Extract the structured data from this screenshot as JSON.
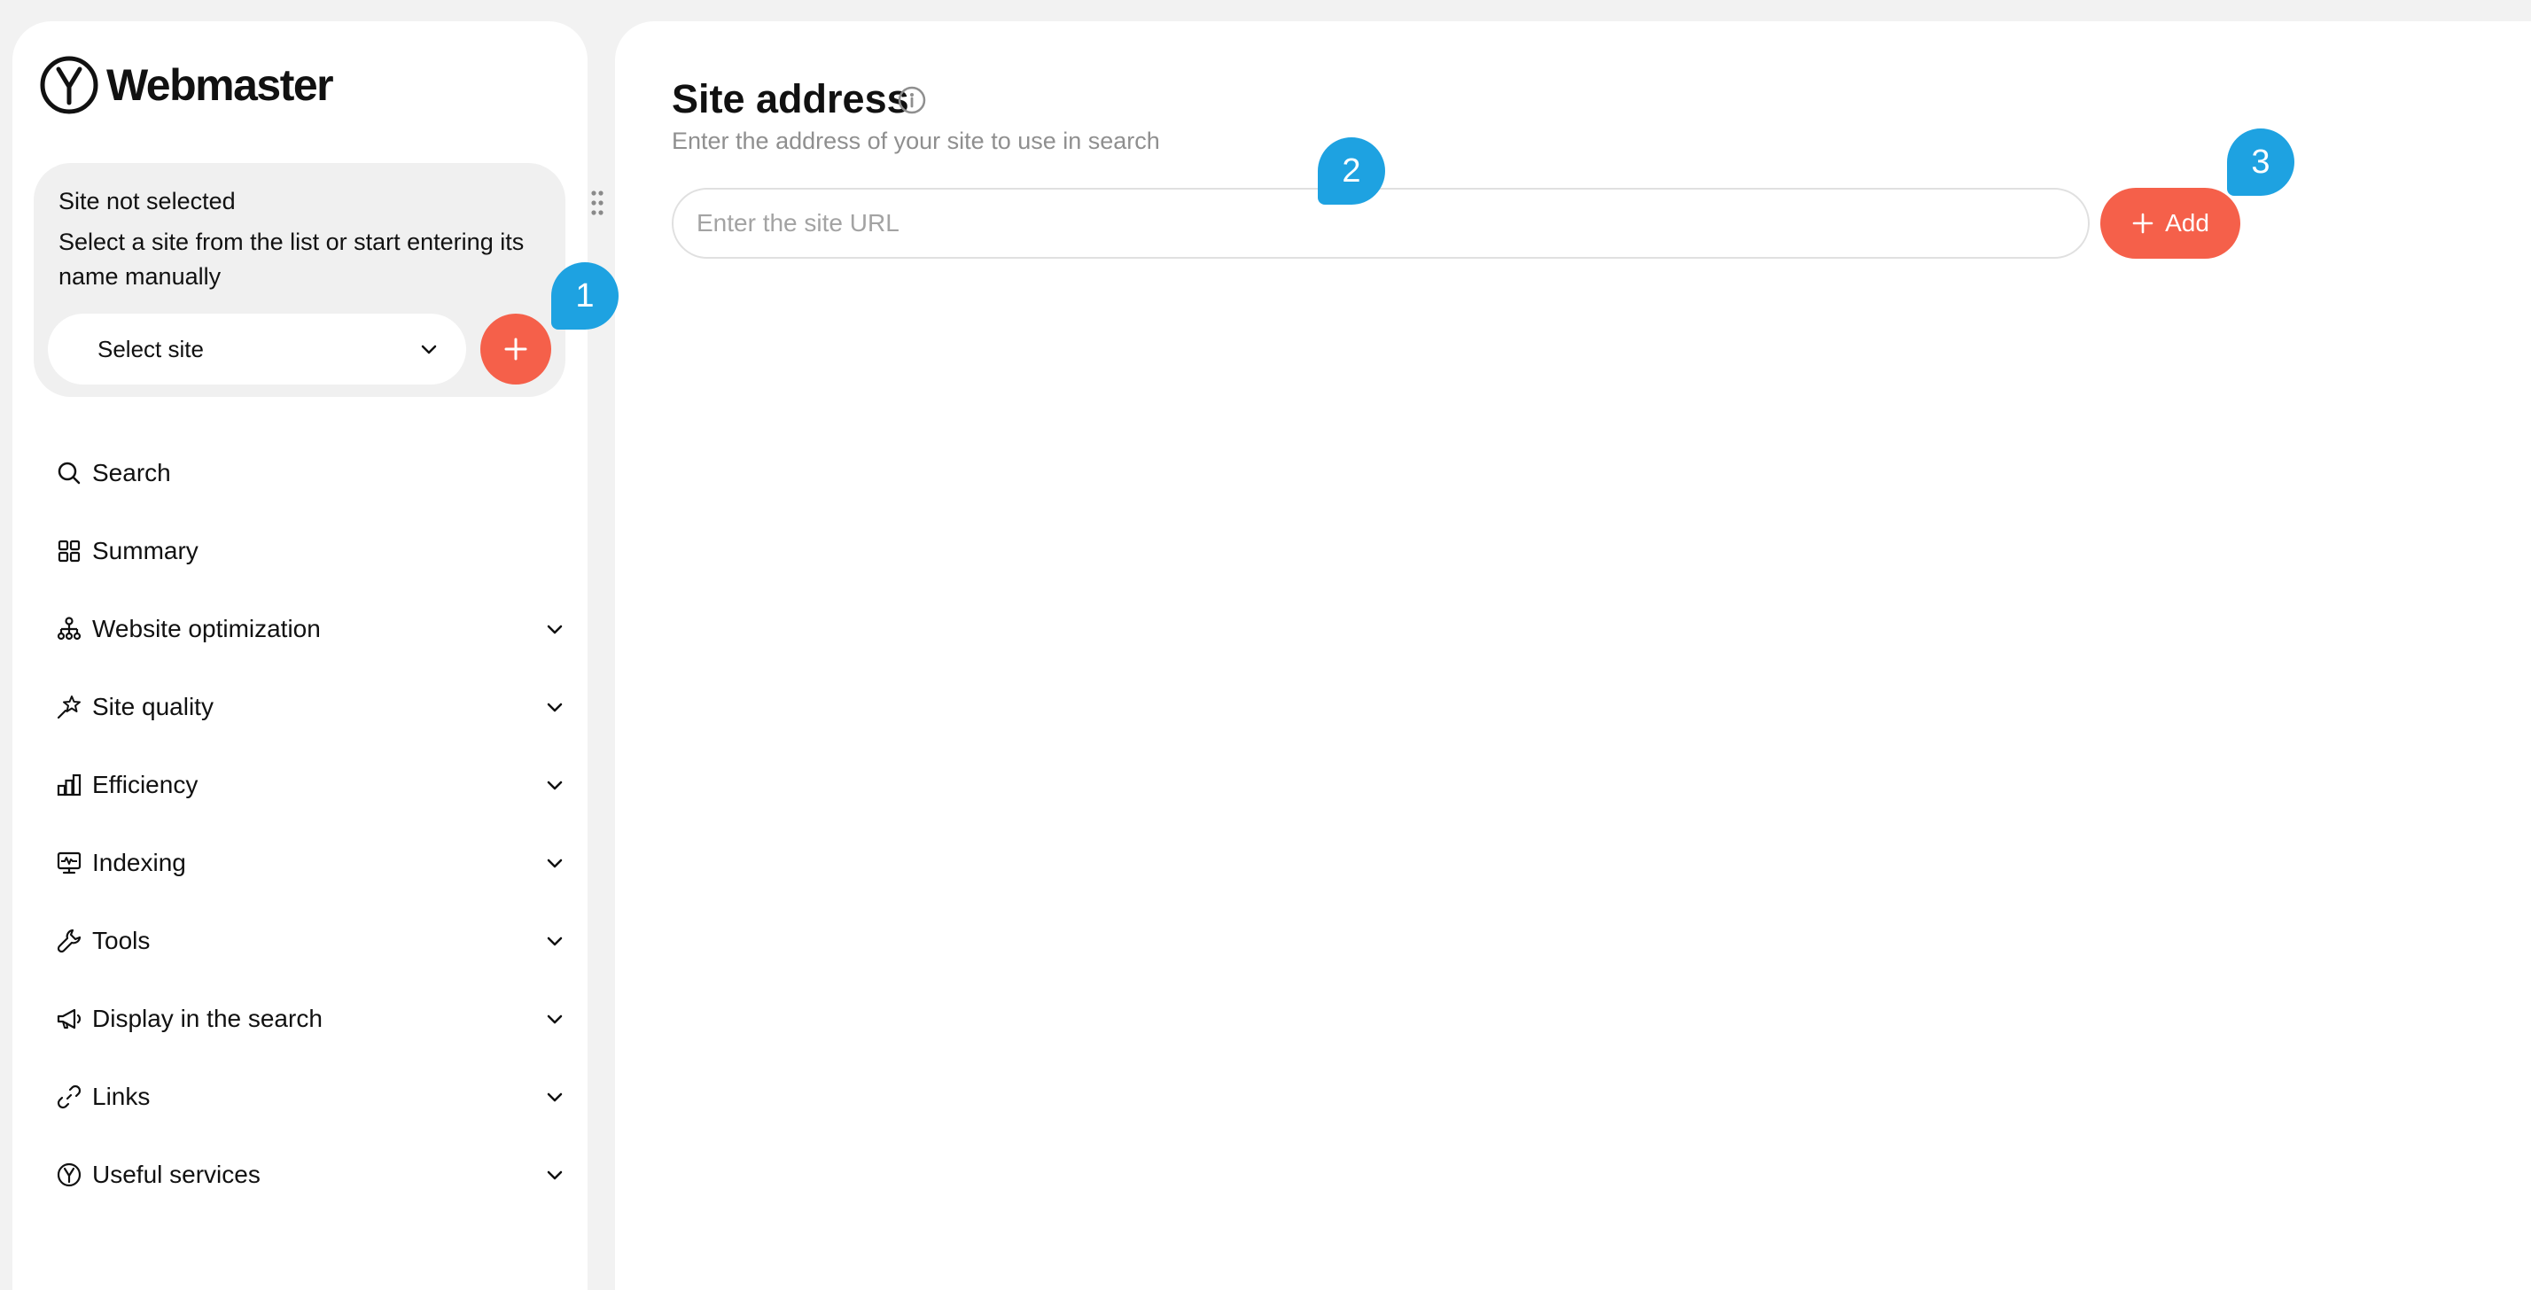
{
  "app": {
    "name": "Webmaster"
  },
  "site_selector": {
    "status": "Site not selected",
    "hint": "Select a site from the list or start entering its name manually",
    "select_label": "Select site"
  },
  "nav": {
    "items": [
      {
        "label": "Search",
        "icon": "search-icon",
        "expandable": false
      },
      {
        "label": "Summary",
        "icon": "grid-icon",
        "expandable": false
      },
      {
        "label": "Website optimization",
        "icon": "sitemap-icon",
        "expandable": true
      },
      {
        "label": "Site quality",
        "icon": "star-wand-icon",
        "expandable": true
      },
      {
        "label": "Efficiency",
        "icon": "bar-chart-icon",
        "expandable": true
      },
      {
        "label": "Indexing",
        "icon": "monitor-pulse-icon",
        "expandable": true
      },
      {
        "label": "Tools",
        "icon": "wrench-icon",
        "expandable": true
      },
      {
        "label": "Display in the search",
        "icon": "megaphone-icon",
        "expandable": true
      },
      {
        "label": "Links",
        "icon": "link-icon",
        "expandable": true
      },
      {
        "label": "Useful services",
        "icon": "yandex-y-icon",
        "expandable": true
      }
    ]
  },
  "main": {
    "title": "Site address",
    "subtitle": "Enter the address of your site to use in search",
    "url_input": {
      "value": "",
      "placeholder": "Enter the site URL"
    },
    "add_label": "Add"
  },
  "annotations": [
    "1",
    "2",
    "3"
  ],
  "colors": {
    "accent": "#f5604a",
    "callout": "#1ea2e1",
    "background": "#f2f2f2",
    "card": "#f0f0f0"
  }
}
